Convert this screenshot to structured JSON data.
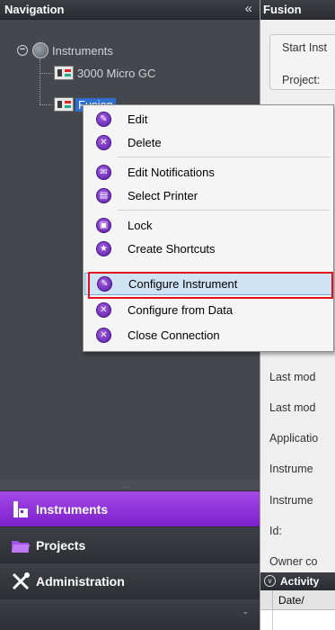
{
  "navigation": {
    "title": "Navigation",
    "collapse_glyph": "«",
    "tree": {
      "root": {
        "label": "Instruments",
        "icon": "globe-icon",
        "toggle": "−"
      },
      "children": [
        {
          "label": "3000 Micro GC",
          "icon": "instrument-icon"
        },
        {
          "label": "Fusion",
          "icon": "instrument-icon",
          "selected": true
        }
      ]
    },
    "bottom": {
      "grip": "....",
      "items": [
        {
          "label": "Instruments",
          "icon": "instruments-icon",
          "active": true
        },
        {
          "label": "Projects",
          "icon": "folder-icon"
        },
        {
          "label": "Administration",
          "icon": "tools-icon"
        }
      ],
      "more_glyph": "⌄"
    }
  },
  "context_menu": {
    "items": [
      {
        "label": "Edit",
        "icon": "pencil-icon"
      },
      {
        "label": "Delete",
        "icon": "delete-icon"
      },
      {
        "label": "Edit Notifications",
        "icon": "envelope-icon"
      },
      {
        "label": "Select Printer",
        "icon": "printer-icon"
      },
      {
        "label": "Lock",
        "icon": "lock-icon"
      },
      {
        "label": "Create Shortcuts",
        "icon": "star-icon"
      },
      {
        "label": "Configure Instrument",
        "icon": "pencil-icon",
        "highlighted": true
      },
      {
        "label": "Configure from Data",
        "icon": "configure-icon"
      },
      {
        "label": "Close Connection",
        "icon": "close-icon"
      }
    ],
    "highlight_color": "#e0141e"
  },
  "right_panel": {
    "title": "Fusion",
    "start_label": "Start Inst",
    "project_label": "Project:",
    "properties": [
      "Last mod",
      "Last mod",
      "Applicatio",
      "Instrume",
      "Instrume",
      "Id:",
      "Owner co"
    ],
    "activity_label": "Activity",
    "date_header": "Date/"
  },
  "colors": {
    "nav_bg": "#44474e",
    "accent_purple": "#8a2be2",
    "selection_blue": "#2f6fd0"
  }
}
